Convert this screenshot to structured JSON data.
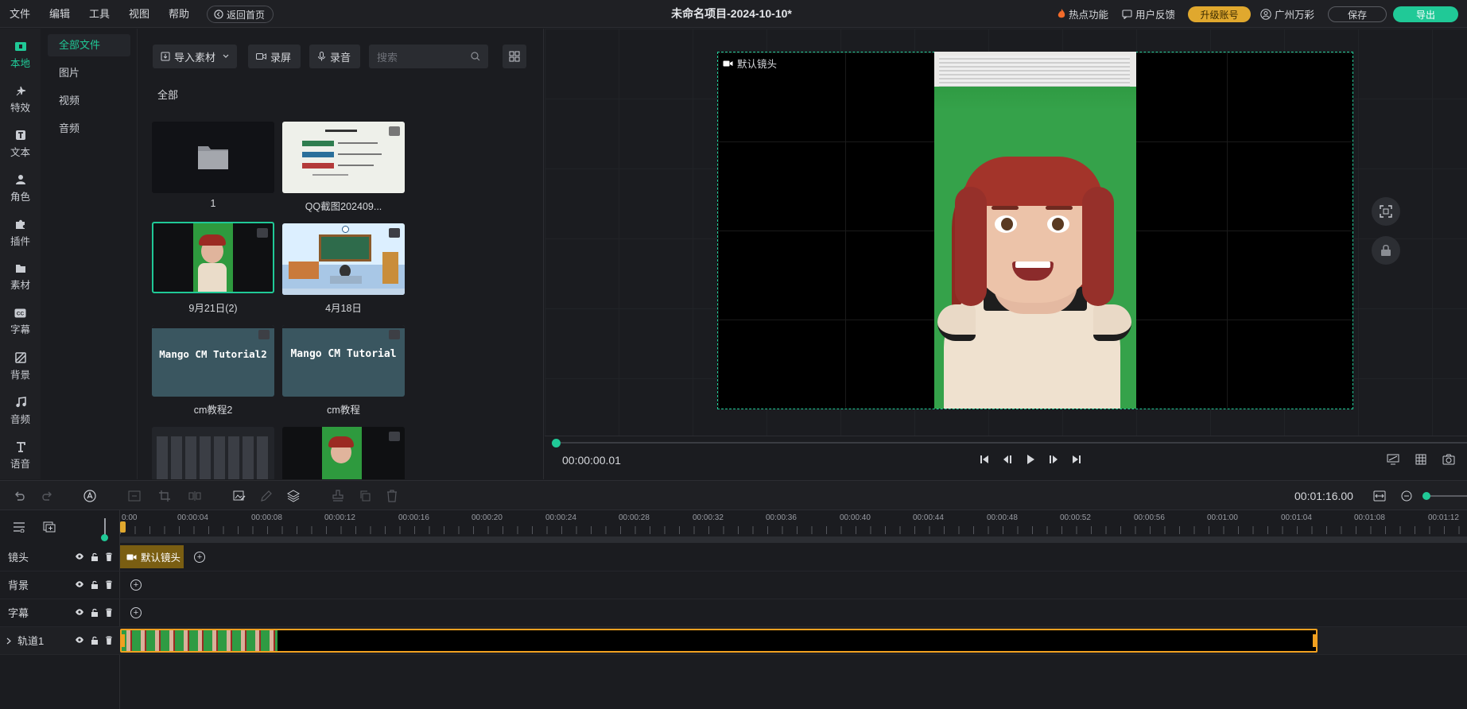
{
  "menu": [
    "文件",
    "编辑",
    "工具",
    "视图",
    "帮助"
  ],
  "home_button": "返回首页",
  "project_title": "未命名项目-2024-10-10*",
  "topbar": {
    "hot": "热点功能",
    "feedback": "用户反馈",
    "upgrade": "升级账号",
    "user": "广州万彩",
    "save": "保存",
    "export": "导出"
  },
  "iconbar": [
    "本地",
    "特效",
    "文本",
    "角色",
    "插件",
    "素材",
    "字幕",
    "背景",
    "音频",
    "语音"
  ],
  "categories": [
    "全部文件",
    "图片",
    "视频",
    "音频"
  ],
  "media_toolbar": {
    "import": "导入素材",
    "record_screen": "录屏",
    "record_audio": "录音",
    "search_placeholder": "搜索"
  },
  "section_label": "全部",
  "media_items": [
    {
      "label": "1"
    },
    {
      "label": "QQ截图202409..."
    },
    {
      "label": "9月21日(2)"
    },
    {
      "label": "4月18日"
    },
    {
      "label": "cm教程2",
      "thumb_text": "Mango CM Tutorial2"
    },
    {
      "label": "cm教程",
      "thumb_text": "Mango CM Tutorial"
    }
  ],
  "stage": {
    "camera_label": "默认镜头",
    "current_time": "00:00:00.01"
  },
  "timeline": {
    "duration": "00:01:16.00",
    "ruler": [
      "0:00",
      "00:00:04",
      "00:00:08",
      "00:00:12",
      "00:00:16",
      "00:00:20",
      "00:00:24",
      "00:00:28",
      "00:00:32",
      "00:00:36",
      "00:00:40",
      "00:00:44",
      "00:00:48",
      "00:00:52",
      "00:00:56",
      "00:01:00",
      "00:01:04",
      "00:01:08",
      "00:01:12"
    ],
    "tracks": [
      "镜头",
      "背景",
      "字幕",
      "轨道1"
    ],
    "camera_clip": "默认镜头"
  },
  "colors": {
    "accent": "#20c997",
    "upgrade": "#e0a82e",
    "clip_border": "#f0a020"
  }
}
